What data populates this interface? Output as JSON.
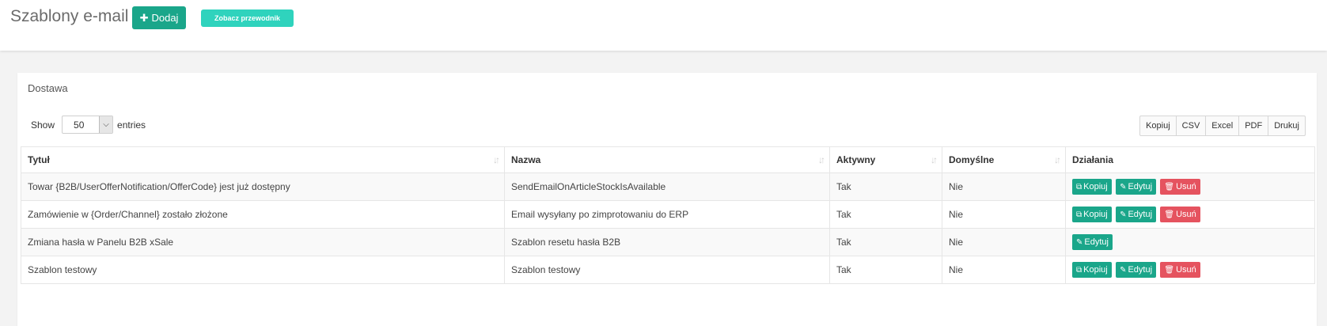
{
  "header": {
    "title": "Szablony e-mail",
    "add_label": "Dodaj",
    "guide_label": "Zobacz przewodnik"
  },
  "card": {
    "title": "Dostawa"
  },
  "length": {
    "show": "Show",
    "value": "50",
    "entries": "entries"
  },
  "export": [
    "Kopiuj",
    "CSV",
    "Excel",
    "PDF",
    "Drukuj"
  ],
  "table": {
    "columns": [
      "Tytuł",
      "Nazwa",
      "Aktywny",
      "Domyślne",
      "Działania"
    ],
    "rows": [
      {
        "title": "Towar {B2B/UserOfferNotification/OfferCode} jest już dostępny",
        "name": "SendEmailOnArticleStockIsAvailable",
        "active": "Tak",
        "default": "Nie"
      },
      {
        "title": "Zamówienie w {Order/Channel} zostało złożone",
        "name": "Email wysyłany po zimprotowaniu do ERP",
        "active": "Tak",
        "default": "Nie"
      },
      {
        "title": "Zmiana hasła w Panelu B2B xSale",
        "name": "Szablon resetu hasła B2B",
        "active": "Tak",
        "default": "Nie"
      },
      {
        "title": "Szablon testowy",
        "name": "Szablon testowy",
        "active": "Tak",
        "default": "Nie"
      }
    ],
    "actions": {
      "copy": "Kopiuj",
      "edit": "Edytuj",
      "delete": "Usuń"
    }
  },
  "colors": {
    "accent": "#1aa68a",
    "guide": "#2fd3bd",
    "danger": "#e5535f"
  }
}
